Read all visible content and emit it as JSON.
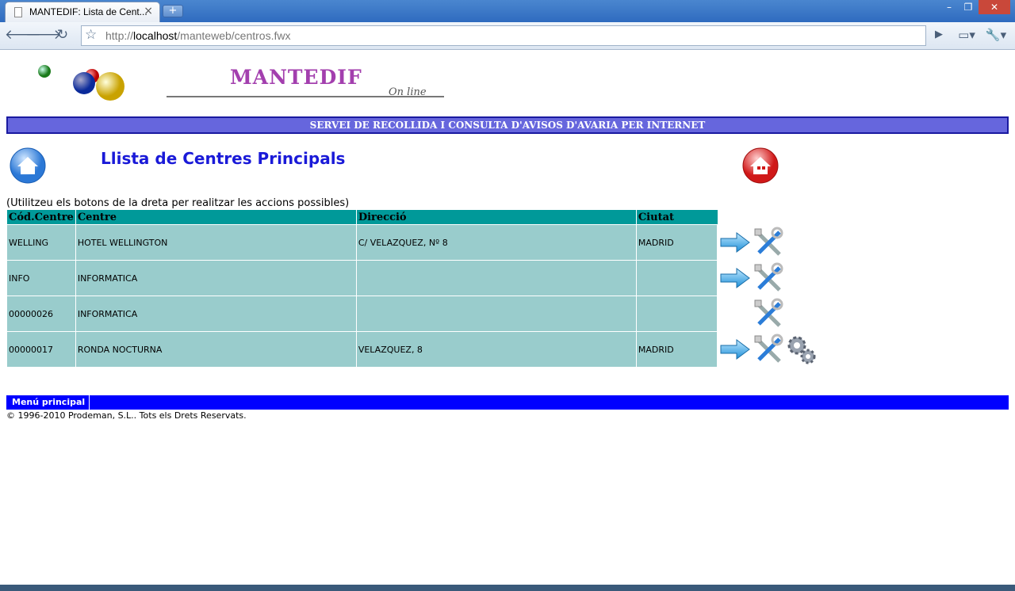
{
  "browser": {
    "tab_title": "MANTEDIF: Lista de Cent...",
    "tab_close": "×",
    "new_tab": "+",
    "url_prefix": "http://",
    "url_host": "localhost",
    "url_path": "/manteweb/centros.fwx",
    "window_controls": {
      "minimize": "–",
      "restore": "❐",
      "close": "✕"
    }
  },
  "header": {
    "logo_text": "MANTEDIF",
    "logo_tagline": "On line",
    "banner": "SERVEI DE RECOLLIDA I CONSULTA D'AVISOS D'AVARIA PER INTERNET"
  },
  "main": {
    "title": "Llista de Centres Principals",
    "hint": "(Utilitzeu els botons de la dreta per realitzar les accions possibles)",
    "columns": [
      "Cód.Centre",
      "Centre",
      "Direcció",
      "Ciutat"
    ],
    "rows": [
      {
        "code": "WELLING",
        "centre": "HOTEL WELLINGTON",
        "address": "C/ VELAZQUEZ, Nº 8",
        "city": "MADRID",
        "actions": [
          "arrow",
          "tools"
        ]
      },
      {
        "code": "INFO",
        "centre": "INFORMATICA",
        "address": "",
        "city": "",
        "actions": [
          "arrow",
          "tools"
        ]
      },
      {
        "code": "00000026",
        "centre": "INFORMATICA",
        "address": "",
        "city": "",
        "actions": [
          "tools"
        ]
      },
      {
        "code": "00000017",
        "centre": "RONDA NOCTURNA",
        "address": "VELAZQUEZ, 8",
        "city": "MADRID",
        "actions": [
          "arrow",
          "tools",
          "gears"
        ]
      }
    ]
  },
  "footer": {
    "menu_label": "Menú principal",
    "copyright": "© 1996-2010 Prodeman, S.L.. Tots els Drets Reservats."
  },
  "colors": {
    "banner_bg": "#6666dd",
    "header_bg": "#009999",
    "row_bg": "#99cccc",
    "title": "#1a1ad8",
    "footer_bar": "#0000ff"
  }
}
